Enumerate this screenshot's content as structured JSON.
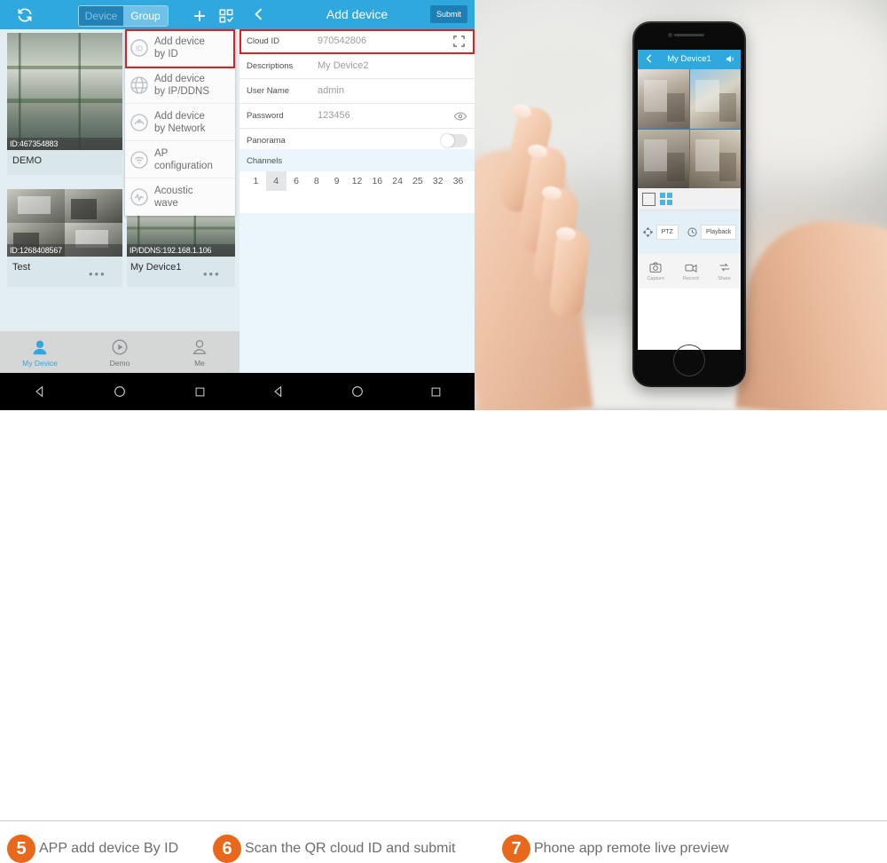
{
  "panel1": {
    "topbar": {
      "refresh_icon": "refresh-icon",
      "segment": {
        "device": "Device",
        "group": "Group"
      },
      "add_icon": "plus-icon",
      "qr_icon": "qr-scan-icon"
    },
    "devices": [
      {
        "id_label": "ID:467354883",
        "name": "DEMO"
      },
      {
        "id_label": "ID:1268408567",
        "name": "Test"
      },
      {
        "id_label": "IP/DDNS:192.168.1.106",
        "name": "My Device1"
      }
    ],
    "menu": [
      {
        "icon": "id-badge-icon",
        "label": "Add device by ID",
        "line1": "Add device",
        "line2": "by ID",
        "highlighted": true
      },
      {
        "icon": "globe-icon",
        "label": "Add device by IP/DDNS",
        "line1": "Add device",
        "line2": "by IP/DDNS",
        "highlighted": false
      },
      {
        "icon": "network-icon",
        "label": "Add device by Network",
        "line1": "Add device",
        "line2": "by Network",
        "highlighted": false
      },
      {
        "icon": "wifi-icon",
        "label": "AP configuration",
        "line1": "AP",
        "line2": "configuration",
        "highlighted": false
      },
      {
        "icon": "sound-wave-icon",
        "label": "Acoustic wave",
        "line1": "Acoustic",
        "line2": "wave",
        "highlighted": false
      }
    ],
    "tabs": [
      {
        "icon": "camera-device-icon",
        "label": "My Device",
        "active": true
      },
      {
        "icon": "play-circle-icon",
        "label": "Demo",
        "active": false
      },
      {
        "icon": "person-icon",
        "label": "Me",
        "active": false
      }
    ],
    "navbar": {
      "back": "triangle-back-icon",
      "home": "circle-home-icon",
      "recents": "square-recents-icon"
    }
  },
  "panel2": {
    "topbar": {
      "back_icon": "chevron-left-icon",
      "title": "Add device",
      "submit": "Submit"
    },
    "fields": [
      {
        "label": "Cloud ID",
        "value": "970542806",
        "trailing_icon": "qr-scan-icon",
        "highlighted": true
      },
      {
        "label": "Descriptions",
        "value": "My Device2",
        "trailing_icon": "",
        "highlighted": false
      },
      {
        "label": "User Name",
        "value": "admin",
        "trailing_icon": "",
        "highlighted": false
      },
      {
        "label": "Password",
        "value": "123456",
        "trailing_icon": "eye-icon",
        "highlighted": false
      },
      {
        "label": "Panorama",
        "value": "",
        "trailing_icon": "toggle-off",
        "highlighted": false
      }
    ],
    "channels": {
      "title": "Channels",
      "options": [
        "1",
        "4",
        "6",
        "8",
        "9",
        "12",
        "16",
        "24",
        "25",
        "32",
        "36"
      ],
      "selected": "4"
    },
    "navbar": {
      "back": "triangle-back-icon",
      "home": "circle-home-icon",
      "recents": "square-recents-icon"
    }
  },
  "panel3": {
    "phone_screen": {
      "topbar": {
        "back_icon": "chevron-left-icon",
        "title": "My Device1",
        "sound_icon": "speaker-icon"
      },
      "layout_buttons": [
        {
          "icon": "single-view-icon",
          "active": false
        },
        {
          "icon": "quad-view-icon",
          "active": true
        }
      ],
      "controls": [
        {
          "icon": "ptz-pad-icon",
          "label": "PTZ"
        },
        {
          "icon": "clock-history-icon",
          "label": "Playback"
        }
      ],
      "bottom_actions": [
        {
          "icon": "camera-icon",
          "label": "Capture"
        },
        {
          "icon": "record-icon",
          "label": "Record"
        },
        {
          "icon": "share-icon",
          "label": "Share"
        }
      ]
    }
  },
  "captions": [
    {
      "number": "5",
      "text": "APP add device By ID"
    },
    {
      "number": "6",
      "text": "Scan the QR cloud ID and submit"
    },
    {
      "number": "7",
      "text": "Phone app remote live preview"
    }
  ],
  "colors": {
    "accent_blue": "#2ea8dd",
    "badge_orange": "#e8691c",
    "highlight_red": "#e02020"
  }
}
